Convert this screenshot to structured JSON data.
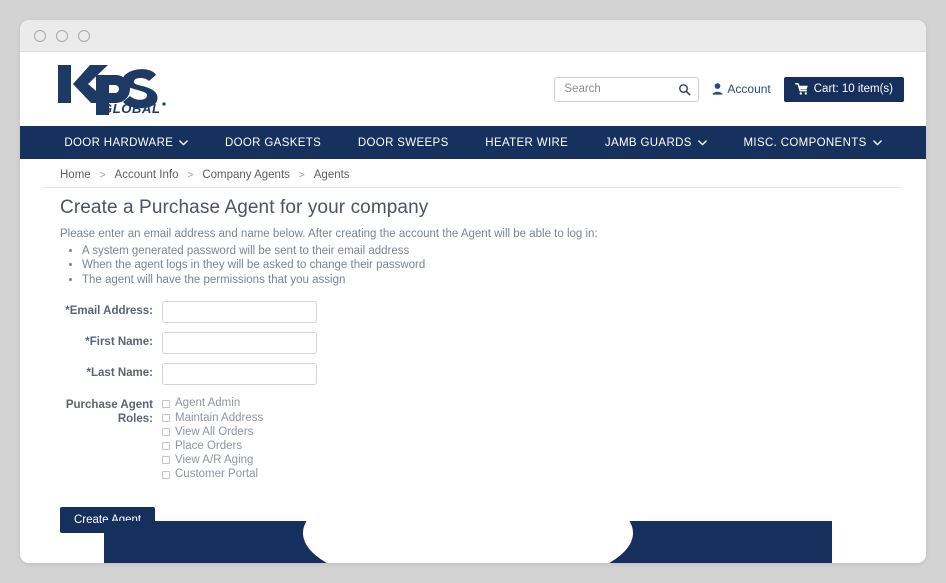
{
  "window": {
    "dots": [
      "window-dot-1",
      "window-dot-2",
      "window-dot-3"
    ]
  },
  "brand": {
    "logo_main": "kps",
    "logo_sub": "GLOBAL",
    "navy": "#15305c",
    "accent_blue": "#2b4a7e"
  },
  "header": {
    "search": {
      "placeholder": "Search",
      "value": "",
      "icon": "search-icon"
    },
    "account": {
      "label": "Account",
      "icon": "user-icon"
    },
    "cart": {
      "label": "Cart: 10 item(s)",
      "icon": "shopping-cart-icon",
      "count": 10
    }
  },
  "nav": {
    "items": [
      {
        "label": "DOOR HARDWARE",
        "has_dropdown": true
      },
      {
        "label": "DOOR GASKETS",
        "has_dropdown": false
      },
      {
        "label": "DOOR SWEEPS",
        "has_dropdown": false
      },
      {
        "label": "HEATER WIRE",
        "has_dropdown": false
      },
      {
        "label": "JAMB GUARDS",
        "has_dropdown": true
      },
      {
        "label": "MISC. COMPONENTS",
        "has_dropdown": true
      }
    ]
  },
  "breadcrumb": {
    "items": [
      "Home",
      "Account Info",
      "Company Agents",
      "Agents"
    ],
    "separator": ">"
  },
  "main": {
    "title": "Create a Purchase Agent for your company",
    "intro": "Please enter an email address and name below. After creating the account the Agent will be able to log in:",
    "bullets": [
      "A system generated password will be sent to their email address",
      "When the agent logs in they will be asked to change their password",
      "The agent will have the permissions that you assign"
    ],
    "fields": [
      {
        "label": "*Email Address:",
        "value": "",
        "placeholder": ""
      },
      {
        "label": "*First Name:",
        "value": "",
        "placeholder": ""
      },
      {
        "label": "*Last Name:",
        "value": "",
        "placeholder": ""
      }
    ],
    "roles_label": "Purchase Agent Roles:",
    "roles": [
      {
        "label": "Agent Admin",
        "checked": false
      },
      {
        "label": "Maintain Address",
        "checked": false
      },
      {
        "label": "View All Orders",
        "checked": false
      },
      {
        "label": "Place Orders",
        "checked": false
      },
      {
        "label": "View A/R Aging",
        "checked": false
      },
      {
        "label": "Customer Portal",
        "checked": false
      }
    ],
    "submit_label": "Create Agent"
  }
}
